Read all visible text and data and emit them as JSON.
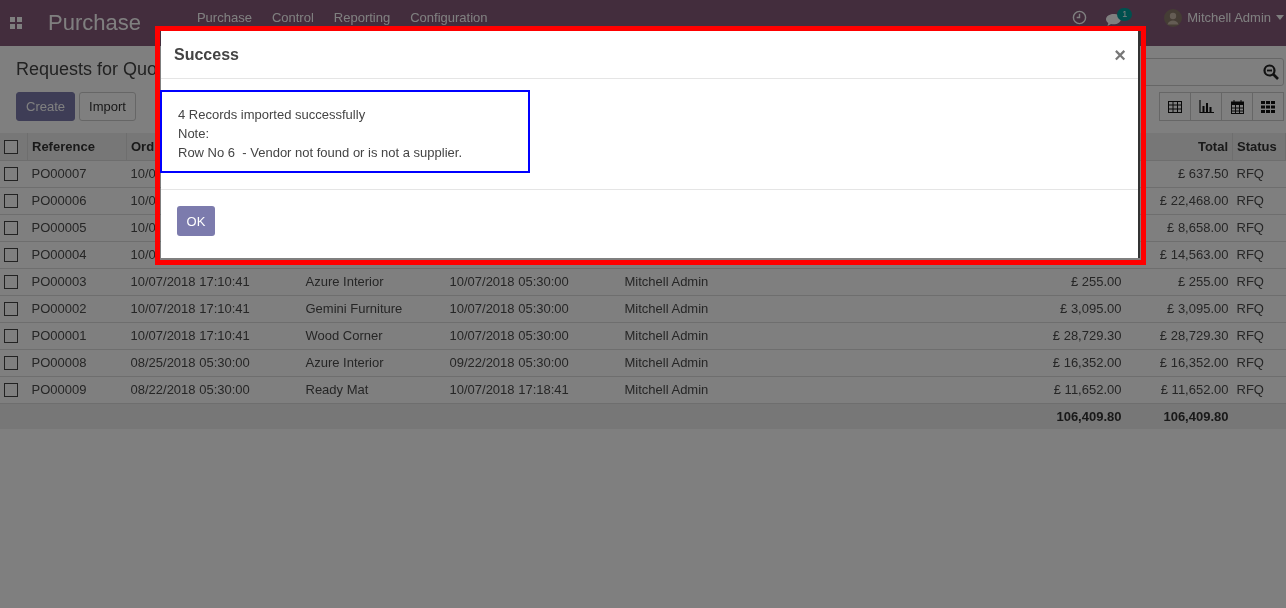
{
  "navbar": {
    "app_name": "Purchase",
    "menus": [
      "Purchase",
      "Control",
      "Reporting",
      "Configuration"
    ],
    "messages_badge": "1",
    "user": "Mitchell Admin"
  },
  "control_panel": {
    "title": "Requests for Quo",
    "buttons": [
      {
        "label": "Create",
        "kind": "primary"
      },
      {
        "label": "Import",
        "kind": "secondary"
      }
    ],
    "views": [
      {
        "kind": "pivot"
      },
      {
        "kind": "graph"
      },
      {
        "kind": "calendar"
      },
      {
        "kind": "kanban"
      }
    ]
  },
  "table": {
    "select_all": {
      "checked": false
    },
    "header": {
      "reference": "Reference",
      "order_date": "Ord",
      "total": "Total",
      "status": "Status"
    },
    "rows": [
      {
        "checked": false,
        "reference": "PO00007",
        "order_date": "10/0",
        "total": "£ 637.50",
        "status": "RFQ"
      },
      {
        "checked": false,
        "reference": "PO00006",
        "order_date": "10/0",
        "total": "£ 22,468.00",
        "status": "RFQ"
      },
      {
        "checked": false,
        "reference": "PO00005",
        "order_date": "10/0",
        "total": "£ 8,658.00",
        "status": "RFQ"
      },
      {
        "checked": false,
        "reference": "PO00004",
        "order_date": "10/0",
        "total": "£ 14,563.00",
        "status": "RFQ"
      },
      {
        "checked": false,
        "reference": "PO00003",
        "order_date": "10/07/2018 17:10:41",
        "vendor": "Azure Interior",
        "scheduled_date": "10/07/2018 05:30:00",
        "representative": "Mitchell Admin",
        "untaxed": "£ 255.00",
        "total": "£ 255.00",
        "status": "RFQ"
      },
      {
        "checked": false,
        "reference": "PO00002",
        "order_date": "10/07/2018 17:10:41",
        "vendor": "Gemini Furniture",
        "scheduled_date": "10/07/2018 05:30:00",
        "representative": "Mitchell Admin",
        "untaxed": "£ 3,095.00",
        "total": "£ 3,095.00",
        "status": "RFQ"
      },
      {
        "checked": false,
        "reference": "PO00001",
        "order_date": "10/07/2018 17:10:41",
        "vendor": "Wood Corner",
        "scheduled_date": "10/07/2018 05:30:00",
        "representative": "Mitchell Admin",
        "untaxed": "£ 28,729.30",
        "total": "£ 28,729.30",
        "status": "RFQ"
      },
      {
        "checked": false,
        "reference": "PO00008",
        "order_date": "08/25/2018 05:30:00",
        "vendor": "Azure Interior",
        "scheduled_date": "09/22/2018 05:30:00",
        "representative": "Mitchell Admin",
        "untaxed": "£ 16,352.00",
        "total": "£ 16,352.00",
        "status": "RFQ"
      },
      {
        "checked": false,
        "reference": "PO00009",
        "order_date": "08/22/2018 05:30:00",
        "vendor": "Ready Mat",
        "scheduled_date": "10/07/2018 17:18:41",
        "representative": "Mitchell Admin",
        "untaxed": "£ 11,652.00",
        "total": "£ 11,652.00",
        "status": "RFQ"
      }
    ],
    "totals": {
      "untaxed": "106,409.80",
      "total": "106,409.80"
    }
  },
  "modal": {
    "title": "Success",
    "close": "×",
    "message": [
      "4 Records imported successfully",
      "Note:",
      "Row No 6  - Vendor not found or is not a supplier."
    ],
    "button": "OK"
  }
}
